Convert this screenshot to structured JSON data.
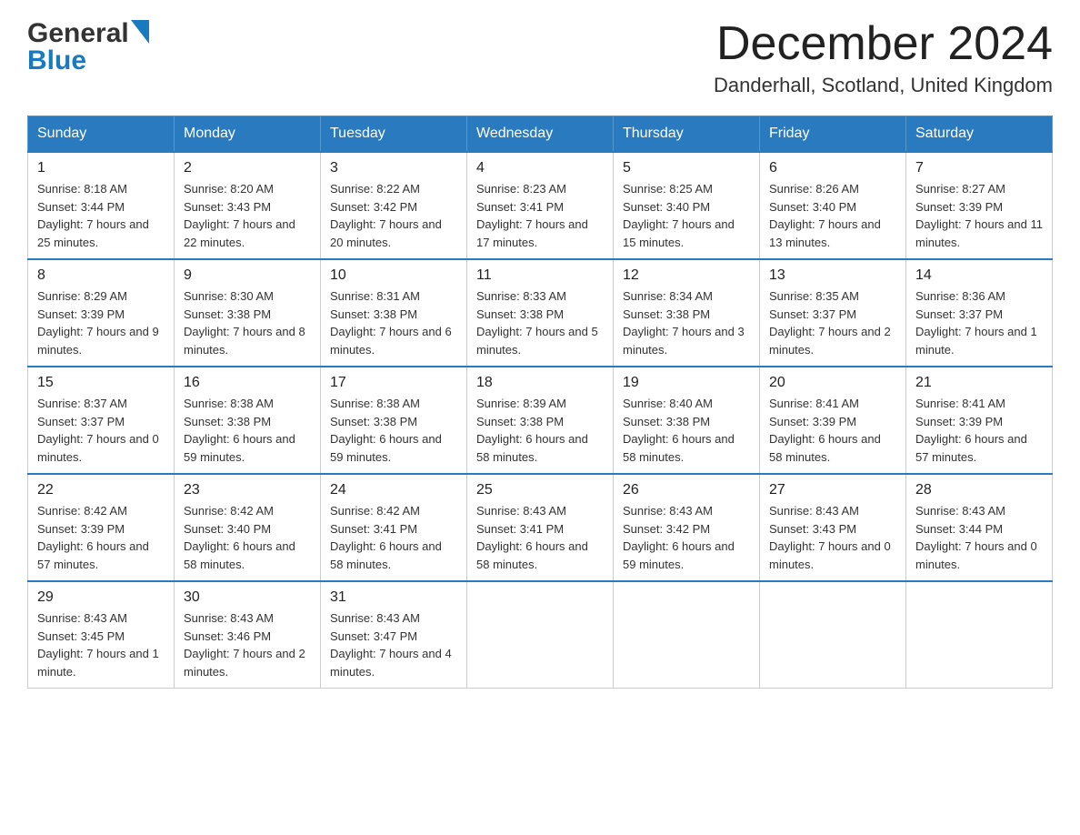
{
  "header": {
    "logo_general": "General",
    "logo_blue": "Blue",
    "month_title": "December 2024",
    "location": "Danderhall, Scotland, United Kingdom"
  },
  "days_of_week": [
    "Sunday",
    "Monday",
    "Tuesday",
    "Wednesday",
    "Thursday",
    "Friday",
    "Saturday"
  ],
  "weeks": [
    [
      {
        "date": "1",
        "sunrise": "8:18 AM",
        "sunset": "3:44 PM",
        "daylight": "7 hours and 25 minutes."
      },
      {
        "date": "2",
        "sunrise": "8:20 AM",
        "sunset": "3:43 PM",
        "daylight": "7 hours and 22 minutes."
      },
      {
        "date": "3",
        "sunrise": "8:22 AM",
        "sunset": "3:42 PM",
        "daylight": "7 hours and 20 minutes."
      },
      {
        "date": "4",
        "sunrise": "8:23 AM",
        "sunset": "3:41 PM",
        "daylight": "7 hours and 17 minutes."
      },
      {
        "date": "5",
        "sunrise": "8:25 AM",
        "sunset": "3:40 PM",
        "daylight": "7 hours and 15 minutes."
      },
      {
        "date": "6",
        "sunrise": "8:26 AM",
        "sunset": "3:40 PM",
        "daylight": "7 hours and 13 minutes."
      },
      {
        "date": "7",
        "sunrise": "8:27 AM",
        "sunset": "3:39 PM",
        "daylight": "7 hours and 11 minutes."
      }
    ],
    [
      {
        "date": "8",
        "sunrise": "8:29 AM",
        "sunset": "3:39 PM",
        "daylight": "7 hours and 9 minutes."
      },
      {
        "date": "9",
        "sunrise": "8:30 AM",
        "sunset": "3:38 PM",
        "daylight": "7 hours and 8 minutes."
      },
      {
        "date": "10",
        "sunrise": "8:31 AM",
        "sunset": "3:38 PM",
        "daylight": "7 hours and 6 minutes."
      },
      {
        "date": "11",
        "sunrise": "8:33 AM",
        "sunset": "3:38 PM",
        "daylight": "7 hours and 5 minutes."
      },
      {
        "date": "12",
        "sunrise": "8:34 AM",
        "sunset": "3:38 PM",
        "daylight": "7 hours and 3 minutes."
      },
      {
        "date": "13",
        "sunrise": "8:35 AM",
        "sunset": "3:37 PM",
        "daylight": "7 hours and 2 minutes."
      },
      {
        "date": "14",
        "sunrise": "8:36 AM",
        "sunset": "3:37 PM",
        "daylight": "7 hours and 1 minute."
      }
    ],
    [
      {
        "date": "15",
        "sunrise": "8:37 AM",
        "sunset": "3:37 PM",
        "daylight": "7 hours and 0 minutes."
      },
      {
        "date": "16",
        "sunrise": "8:38 AM",
        "sunset": "3:38 PM",
        "daylight": "6 hours and 59 minutes."
      },
      {
        "date": "17",
        "sunrise": "8:38 AM",
        "sunset": "3:38 PM",
        "daylight": "6 hours and 59 minutes."
      },
      {
        "date": "18",
        "sunrise": "8:39 AM",
        "sunset": "3:38 PM",
        "daylight": "6 hours and 58 minutes."
      },
      {
        "date": "19",
        "sunrise": "8:40 AM",
        "sunset": "3:38 PM",
        "daylight": "6 hours and 58 minutes."
      },
      {
        "date": "20",
        "sunrise": "8:41 AM",
        "sunset": "3:39 PM",
        "daylight": "6 hours and 58 minutes."
      },
      {
        "date": "21",
        "sunrise": "8:41 AM",
        "sunset": "3:39 PM",
        "daylight": "6 hours and 57 minutes."
      }
    ],
    [
      {
        "date": "22",
        "sunrise": "8:42 AM",
        "sunset": "3:39 PM",
        "daylight": "6 hours and 57 minutes."
      },
      {
        "date": "23",
        "sunrise": "8:42 AM",
        "sunset": "3:40 PM",
        "daylight": "6 hours and 58 minutes."
      },
      {
        "date": "24",
        "sunrise": "8:42 AM",
        "sunset": "3:41 PM",
        "daylight": "6 hours and 58 minutes."
      },
      {
        "date": "25",
        "sunrise": "8:43 AM",
        "sunset": "3:41 PM",
        "daylight": "6 hours and 58 minutes."
      },
      {
        "date": "26",
        "sunrise": "8:43 AM",
        "sunset": "3:42 PM",
        "daylight": "6 hours and 59 minutes."
      },
      {
        "date": "27",
        "sunrise": "8:43 AM",
        "sunset": "3:43 PM",
        "daylight": "7 hours and 0 minutes."
      },
      {
        "date": "28",
        "sunrise": "8:43 AM",
        "sunset": "3:44 PM",
        "daylight": "7 hours and 0 minutes."
      }
    ],
    [
      {
        "date": "29",
        "sunrise": "8:43 AM",
        "sunset": "3:45 PM",
        "daylight": "7 hours and 1 minute."
      },
      {
        "date": "30",
        "sunrise": "8:43 AM",
        "sunset": "3:46 PM",
        "daylight": "7 hours and 2 minutes."
      },
      {
        "date": "31",
        "sunrise": "8:43 AM",
        "sunset": "3:47 PM",
        "daylight": "7 hours and 4 minutes."
      },
      null,
      null,
      null,
      null
    ]
  ]
}
